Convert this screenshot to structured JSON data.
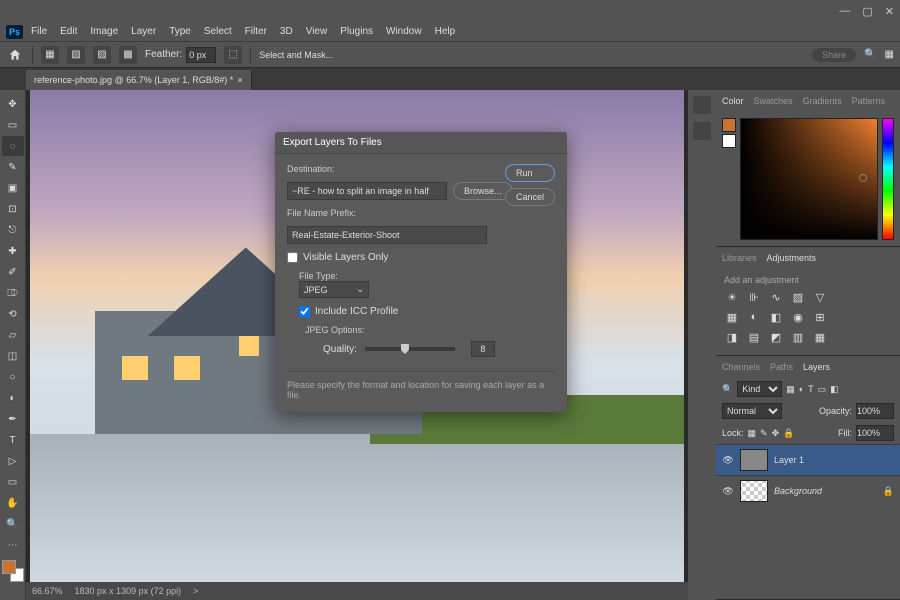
{
  "app": {
    "logo": "Ps"
  },
  "menus": [
    "File",
    "Edit",
    "Image",
    "Layer",
    "Type",
    "Select",
    "Filter",
    "3D",
    "View",
    "Plugins",
    "Window",
    "Help"
  ],
  "optbar": {
    "feather_label": "Feather:",
    "feather_value": "0 px",
    "select_mask": "Select and Mask...",
    "share": "Share"
  },
  "tab": {
    "title": "reference-photo.jpg @ 66.7% (Layer 1, RGB/8#) *",
    "close": "×"
  },
  "status": {
    "zoom": "66.67%",
    "dims": "1830 px x 1309 px (72 ppi)",
    "chev": ">"
  },
  "color_panel": {
    "tabs": [
      "Color",
      "Swatches",
      "Gradients",
      "Patterns"
    ],
    "current": "#c87430"
  },
  "lib_panel": {
    "tabs": [
      "Libraries",
      "Adjustments"
    ],
    "hint": "Add an adjustment"
  },
  "layers_panel": {
    "tabs": [
      "Channels",
      "Paths",
      "Layers"
    ],
    "kind": "Kind",
    "blend": "Normal",
    "opacity_label": "Opacity:",
    "opacity": "100%",
    "lock_label": "Lock:",
    "fill_label": "Fill:",
    "fill": "100%",
    "items": [
      {
        "name": "Layer 1",
        "visible": true,
        "locked": false,
        "selected": true
      },
      {
        "name": "Background",
        "visible": true,
        "locked": true,
        "selected": false,
        "italic": true
      }
    ]
  },
  "dialog": {
    "title": "Export Layers To Files",
    "destination_label": "Destination:",
    "destination_value": "~RE - how to split an image in half",
    "browse": "Browse...",
    "run": "Run",
    "cancel": "Cancel",
    "prefix_label": "File Name Prefix:",
    "prefix_value": "Real-Estate-Exterior-Shoot",
    "visible_only": "Visible Layers Only",
    "filetype_label": "File Type:",
    "filetype_value": "JPEG",
    "icc": "Include ICC Profile",
    "jpeg_options": "JPEG Options:",
    "quality_label": "Quality:",
    "quality_value": "8",
    "hint": "Please specify the format and location for saving each layer as a file."
  }
}
